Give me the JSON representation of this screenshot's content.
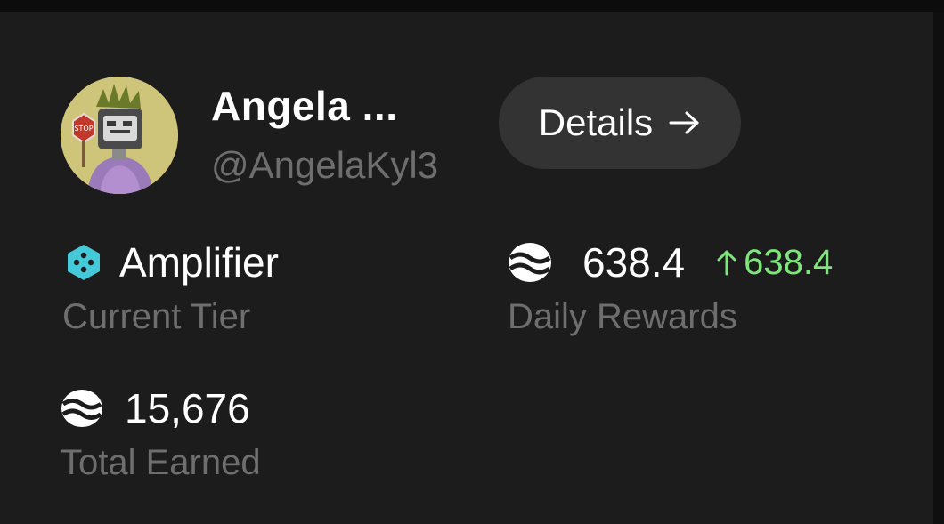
{
  "profile": {
    "name": "Angela ...",
    "handle": "@AngelaKyl3",
    "avatar_icon": "avatar-illustration"
  },
  "details_button": {
    "label": "Details",
    "icon": "arrow-right-icon"
  },
  "stats": {
    "tier": {
      "value": "Amplifier",
      "caption": "Current Tier",
      "icon": "tier-hexagon-icon",
      "icon_color": "#45c8d8"
    },
    "daily_rewards": {
      "value": "638.4",
      "delta": "638.4",
      "caption": "Daily Rewards",
      "icon": "coin-wave-icon",
      "delta_color": "#7ee67a"
    },
    "total_earned": {
      "value": "15,676",
      "caption": "Total Earned",
      "icon": "coin-wave-icon"
    }
  },
  "colors": {
    "background": "#1c1c1c",
    "muted_text": "#6e6e6e",
    "button_bg": "#333333",
    "positive": "#7ee67a"
  }
}
